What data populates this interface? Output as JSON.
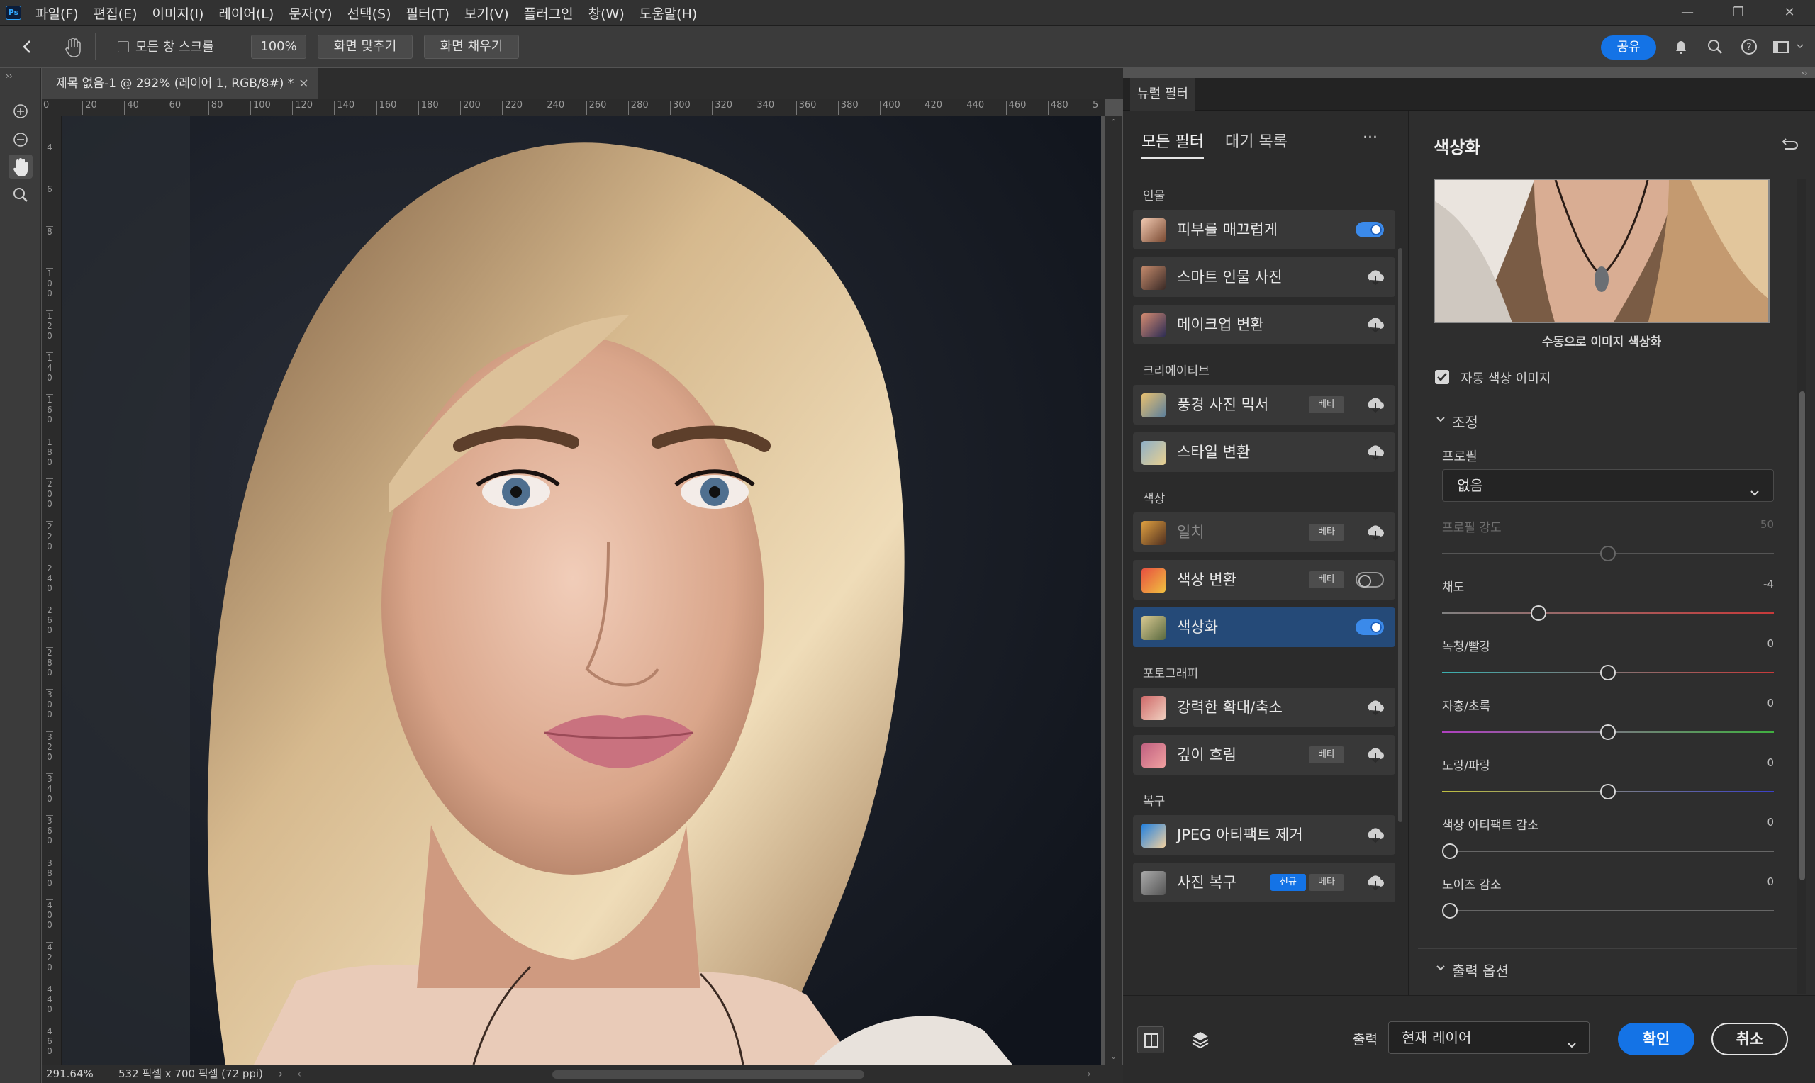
{
  "app": {
    "logo": "Ps"
  },
  "menu": [
    "파일(F)",
    "편집(E)",
    "이미지(I)",
    "레이어(L)",
    "문자(Y)",
    "선택(S)",
    "필터(T)",
    "보기(V)",
    "플러그인",
    "창(W)",
    "도움말(H)"
  ],
  "window_controls": {
    "minimize": "—",
    "restore": "❐",
    "close": "✕"
  },
  "options": {
    "scroll_all_windows": "모든 창 스크롤",
    "zoom_100": "100%",
    "fit_screen": "화면 맞추기",
    "fill_screen": "화면 채우기",
    "share": "공유"
  },
  "document": {
    "tab_title": "제목 없음-1 @ 292% (레이어 1, RGB/8#) *",
    "h_ruler": [
      "0",
      "20",
      "40",
      "60",
      "80",
      "100",
      "120",
      "140",
      "160",
      "180",
      "200",
      "220",
      "240",
      "260",
      "280",
      "300",
      "320",
      "340",
      "360",
      "380",
      "400",
      "420",
      "440",
      "460",
      "480",
      "5"
    ],
    "v_ruler": [
      "4",
      "6",
      "8",
      "100",
      "120",
      "140",
      "160",
      "180",
      "200",
      "220",
      "240",
      "260",
      "280",
      "300",
      "320",
      "340",
      "360",
      "380",
      "400",
      "420",
      "440",
      "460",
      "4"
    ],
    "zoom": "291.64%",
    "dimensions": "532 픽셀 x 700 픽셀 (72 ppi)"
  },
  "neural_filters": {
    "panel_title": "뉴럴 필터",
    "tabs": [
      "모든 필터",
      "대기 목록"
    ],
    "more": "···",
    "categories": [
      {
        "name": "인물",
        "filters": [
          {
            "label": "피부를 매끄럽게",
            "state": "on"
          },
          {
            "label": "스마트 인물 사진",
            "state": "cloud"
          },
          {
            "label": "메이크업 변환",
            "state": "cloud"
          }
        ]
      },
      {
        "name": "크리에이티브",
        "filters": [
          {
            "label": "풍경 사진 믹서",
            "beta": "베타",
            "state": "cloud"
          },
          {
            "label": "스타일 변환",
            "state": "cloud"
          }
        ]
      },
      {
        "name": "색상",
        "filters": [
          {
            "label": "일치",
            "beta": "베타",
            "state": "cloud"
          },
          {
            "label": "색상 변환",
            "beta": "베타",
            "state": "off"
          },
          {
            "label": "색상화",
            "state": "on"
          }
        ]
      },
      {
        "name": "포토그래피",
        "filters": [
          {
            "label": "강력한 확대/축소",
            "state": "cloud"
          },
          {
            "label": "깊이 흐림",
            "beta": "베타",
            "state": "cloud"
          }
        ]
      },
      {
        "name": "복구",
        "filters": [
          {
            "label": "JPEG 아티팩트 제거",
            "state": "cloud"
          },
          {
            "label": "사진 복구",
            "new": "신규",
            "beta": "베타",
            "state": "cloud"
          }
        ]
      }
    ]
  },
  "colorize": {
    "title": "색상화",
    "preview_caption": "수동으로 이미지 색상화",
    "auto_color": "자동 색상 이미지",
    "adjust_section": "조정",
    "profile_label": "프로필",
    "profile_value": "없음",
    "sliders": [
      {
        "label": "프로필 강도",
        "value": "50",
        "level": 0.5,
        "disabled": true
      },
      {
        "label": "채도",
        "value": "-4",
        "level": 0.28,
        "disabled": false
      },
      {
        "label": "녹청/빨강",
        "value": "0",
        "level": 0.5,
        "disabled": false
      },
      {
        "label": "자홍/초록",
        "value": "0",
        "level": 0.5,
        "disabled": false
      },
      {
        "label": "노랑/파랑",
        "value": "0",
        "level": 0.5,
        "disabled": false
      },
      {
        "label": "색상 아티팩트 감소",
        "value": "0",
        "level": 0,
        "disabled": false
      },
      {
        "label": "노이즈 감소",
        "value": "0",
        "level": 0,
        "disabled": false
      }
    ],
    "output_section": "출력 옵션"
  },
  "footer": {
    "output_label": "출력",
    "output_value": "현재 레이어",
    "ok": "확인",
    "cancel": "취소"
  }
}
